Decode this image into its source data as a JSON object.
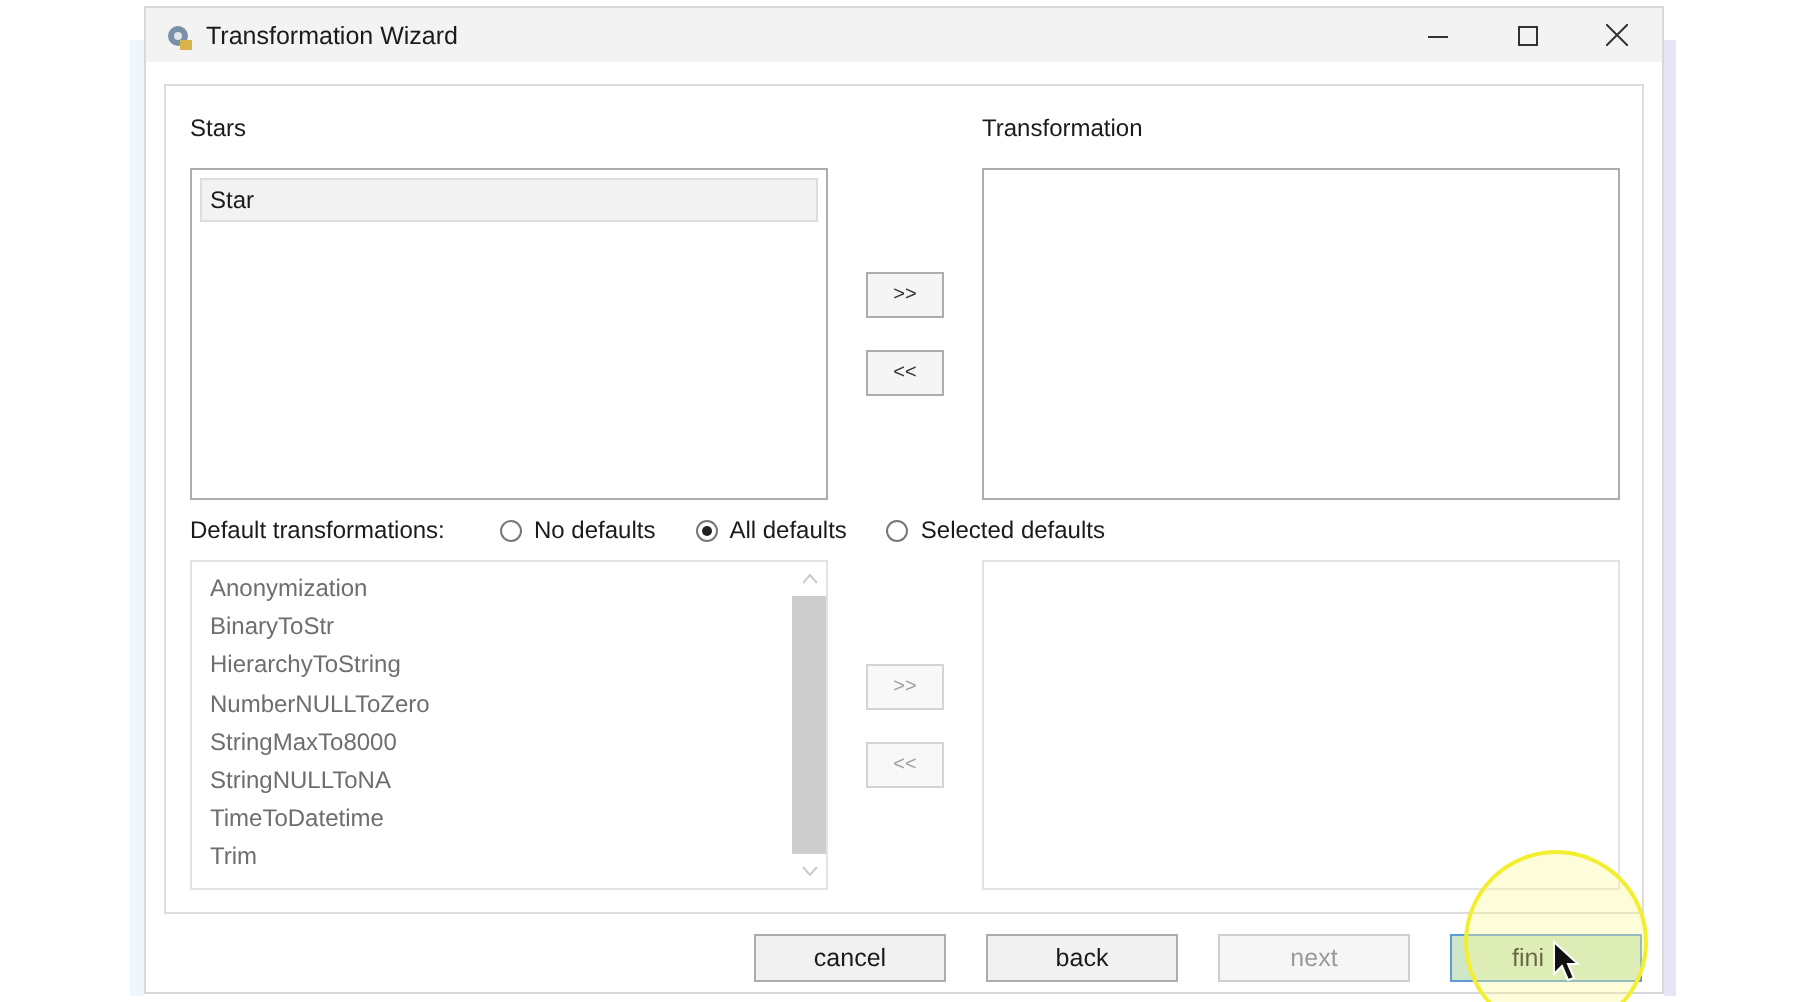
{
  "window": {
    "title": "Transformation Wizard"
  },
  "stars": {
    "label": "Stars",
    "items": [
      {
        "label": "Star",
        "selected": true
      }
    ]
  },
  "transformation": {
    "label": "Transformation"
  },
  "upper_moves": [
    {
      "label": ">>",
      "disabled": false
    },
    {
      "label": "<<",
      "disabled": false
    }
  ],
  "default_transformations": {
    "label": "Default transformations:",
    "options": [
      {
        "label": "No defaults",
        "selected": false
      },
      {
        "label": "All defaults",
        "selected": true
      },
      {
        "label": "Selected defaults",
        "selected": false
      }
    ]
  },
  "default_list": {
    "items": [
      "Anonymization",
      "BinaryToStr",
      "HierarchyToString",
      "NumberNULLToZero",
      "StringMaxTo8000",
      "StringNULLToNA",
      "TimeToDatetime",
      "Trim"
    ]
  },
  "lower_moves": [
    {
      "label": ">>",
      "disabled": true
    },
    {
      "label": "<<",
      "disabled": true
    }
  ],
  "buttons": [
    {
      "label": "cancel",
      "disabled": false,
      "focused": false
    },
    {
      "label": "back",
      "disabled": false,
      "focused": false
    },
    {
      "label": "next",
      "disabled": true,
      "focused": false
    },
    {
      "label": "fini",
      "disabled": false,
      "focused": true
    }
  ]
}
